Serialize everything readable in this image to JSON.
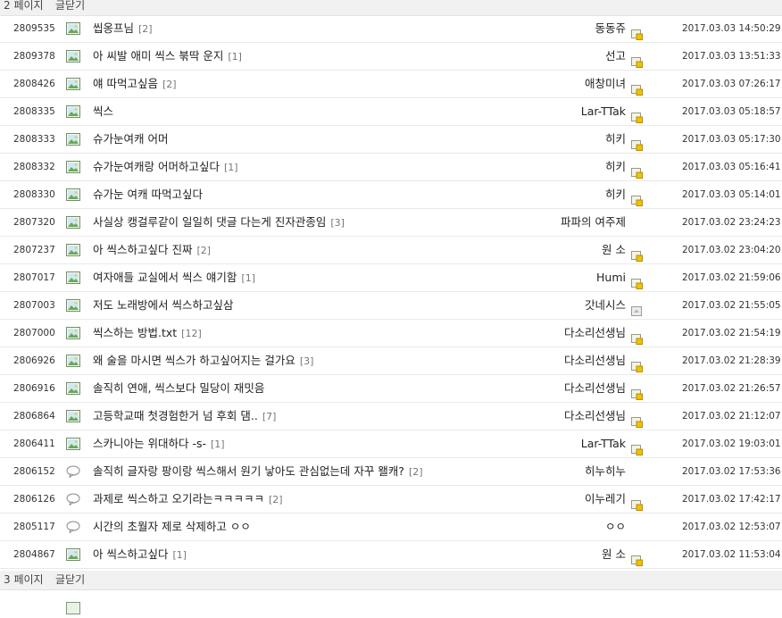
{
  "page_bar_top": {
    "page_label": "2 페이지",
    "close_label": "글닫기"
  },
  "page_bar_bottom": {
    "page_label": "3 페이지",
    "close_label": "글닫기"
  },
  "rows": [
    {
      "num": "2809535",
      "icon": "image-icon",
      "title": "씹옹프님",
      "count": "[2]",
      "nick": "동동쥬",
      "badge": "gold-icon",
      "date": "2017.03.03 14:50:29"
    },
    {
      "num": "2809378",
      "icon": "image-icon",
      "title": "아 씨발 애미 씩스 붂딱 운지",
      "count": "[1]",
      "nick": "선고",
      "badge": "gold-icon",
      "date": "2017.03.03 13:51:33"
    },
    {
      "num": "2808426",
      "icon": "image-icon",
      "title": "얘 따먹고싶음",
      "count": "[2]",
      "nick": "애창미녀",
      "badge": "gold-icon",
      "date": "2017.03.03 07:26:17"
    },
    {
      "num": "2808335",
      "icon": "image-icon",
      "title": "씩스",
      "count": "",
      "nick": "Lar-TTak",
      "badge": "gold-icon",
      "date": "2017.03.03 05:18:57"
    },
    {
      "num": "2808333",
      "icon": "image-icon",
      "title": "슈가눈여캐 어머",
      "count": "",
      "nick": "히키",
      "badge": "gold-icon",
      "date": "2017.03.03 05:17:30"
    },
    {
      "num": "2808332",
      "icon": "image-icon",
      "title": "슈가눈여캐랑 어머하고싶다",
      "count": "[1]",
      "nick": "히키",
      "badge": "gold-icon",
      "date": "2017.03.03 05:16:41"
    },
    {
      "num": "2808330",
      "icon": "image-icon",
      "title": "슈가눈 여캐 따먹고싶다",
      "count": "",
      "nick": "히키",
      "badge": "gold-icon",
      "date": "2017.03.03 05:14:01"
    },
    {
      "num": "2807320",
      "icon": "image-icon",
      "title": "사실상 캥걸루같이 일일히 댓글 다는게 진자관종임",
      "count": "[3]",
      "nick": "파파의 여주제",
      "badge": "",
      "date": "2017.03.02 23:24:23"
    },
    {
      "num": "2807237",
      "icon": "image-icon",
      "title": "아 씩스하고싶다 진짜",
      "count": "[2]",
      "nick": "원 소",
      "badge": "gold-icon",
      "date": "2017.03.02 23:04:20"
    },
    {
      "num": "2807017",
      "icon": "image-icon",
      "title": "여자애들 교실에서 씩스 얘기함",
      "count": "[1]",
      "nick": "Humi",
      "badge": "gold-icon",
      "date": "2017.03.02 21:59:06"
    },
    {
      "num": "2807003",
      "icon": "image-icon",
      "title": "저도 노래방에서 씩스하고싶삼",
      "count": "",
      "nick": "갓네시스",
      "badge": "gray-icon",
      "date": "2017.03.02 21:55:05"
    },
    {
      "num": "2807000",
      "icon": "image-icon",
      "title": "씩스하는 방법.txt",
      "count": "[12]",
      "nick": "다소리선생님",
      "badge": "gold-icon",
      "date": "2017.03.02 21:54:19"
    },
    {
      "num": "2806926",
      "icon": "image-icon",
      "title": "왜 술을 마시면 씩스가 하고싶어지는 걸가요",
      "count": "[3]",
      "nick": "다소리선생님",
      "badge": "gold-icon",
      "date": "2017.03.02 21:28:39"
    },
    {
      "num": "2806916",
      "icon": "image-icon",
      "title": "솔직히 연애, 씩스보다 밀당이 재밋음",
      "count": "",
      "nick": "다소리선생님",
      "badge": "gold-icon",
      "date": "2017.03.02 21:26:57"
    },
    {
      "num": "2806864",
      "icon": "image-icon",
      "title": "고등학교때 첫경험한거 넘 후회 댐..",
      "count": "[7]",
      "nick": "다소리선생님",
      "badge": "gold-icon",
      "date": "2017.03.02 21:12:07"
    },
    {
      "num": "2806411",
      "icon": "image-icon",
      "title": "스카니아는 위대하다 -s-",
      "count": "[1]",
      "nick": "Lar-TTak",
      "badge": "gold-icon",
      "date": "2017.03.02 19:03:01"
    },
    {
      "num": "2806152",
      "icon": "speech-bubble-icon",
      "title": "솔직히 글자랑 팡이랑 씩스해서 원기 낳아도 관심없는데 자꾸 왤캐?",
      "count": "[2]",
      "nick": "히누히누",
      "badge": "",
      "date": "2017.03.02 17:53:36"
    },
    {
      "num": "2806126",
      "icon": "speech-bubble-icon",
      "title": "과제로 씩스하고 오기라는ㅋㅋㅋㅋㅋ",
      "count": "[2]",
      "nick": "이누레기",
      "badge": "gold-icon",
      "date": "2017.03.02 17:42:17"
    },
    {
      "num": "2805117",
      "icon": "speech-bubble-icon",
      "title": "시간의 초월자 제로 삭제하고 ㅇㅇ",
      "count": "",
      "nick": "ㅇㅇ",
      "badge": "",
      "date": "2017.03.02 12:53:07"
    },
    {
      "num": "2804867",
      "icon": "image-icon",
      "title": "아 씩스하고싶다",
      "count": "[1]",
      "nick": "원 소",
      "badge": "gold-icon",
      "date": "2017.03.02 11:53:04"
    }
  ],
  "next_row_partial": {
    "num": "",
    "icon": "image-icon",
    "title": "",
    "nick": "",
    "date": ""
  }
}
